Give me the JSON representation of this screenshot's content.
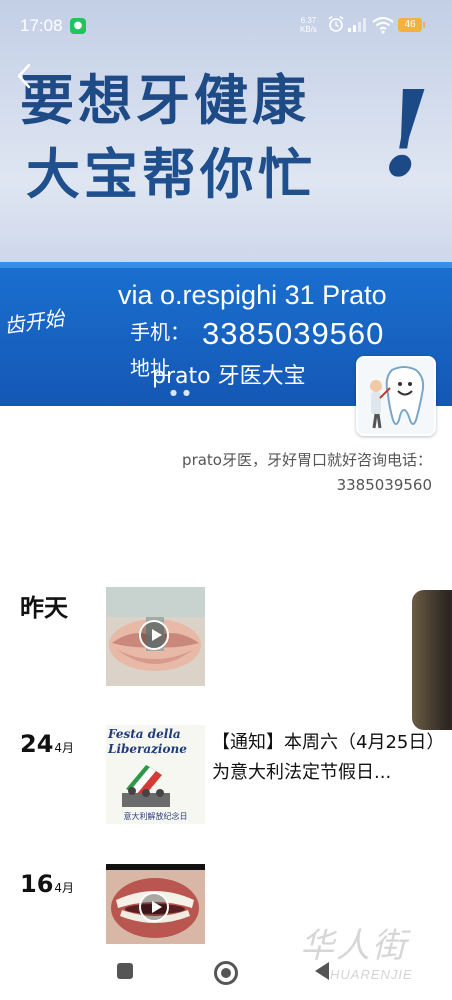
{
  "status_bar": {
    "time": "17:08",
    "net_speed_value": "6.37",
    "net_speed_unit": "KB/s",
    "battery": "46",
    "icons": [
      "wechat-icon",
      "alarm-icon",
      "signal-icon",
      "wifi-icon",
      "battery-icon"
    ]
  },
  "cover": {
    "headline_line1": "要想牙健康",
    "headline_line2": "大宝帮你忙",
    "exclaim": "!",
    "address": "via o.respighi 31 Prato",
    "phone_label": "手机：",
    "phone": "3385039560",
    "addr_label": "地址",
    "script_text": "齿开始",
    "back_icon": "chevron-left-icon"
  },
  "profile": {
    "name": "prato 牙医大宝",
    "signature_line1": "prato牙医，牙好胃口就好咨询电话：",
    "signature_line2": "3385039560"
  },
  "moments": [
    {
      "date": "昨天",
      "type": "video"
    },
    {
      "day": "24",
      "month": "4月",
      "type": "image+text",
      "thumb_title1": "Festa della",
      "thumb_title2": "Liberazione",
      "thumb_caption": "意大利解放纪念日",
      "text": "【通知】本周六（4月25日）为意大利法定节假日..."
    },
    {
      "day": "16",
      "month": "4月",
      "type": "video"
    }
  ],
  "nav": {
    "icons": [
      "recents-square-icon",
      "home-circle-icon",
      "back-triangle-icon"
    ]
  },
  "watermark": {
    "cn": "华人街",
    "en": "HUARENJIE"
  },
  "colors": {
    "band_blue": "#1a6fcf",
    "headline_blue": "#1e4a86",
    "battery": "#f3b23d",
    "wechat_green": "#22c35d"
  }
}
